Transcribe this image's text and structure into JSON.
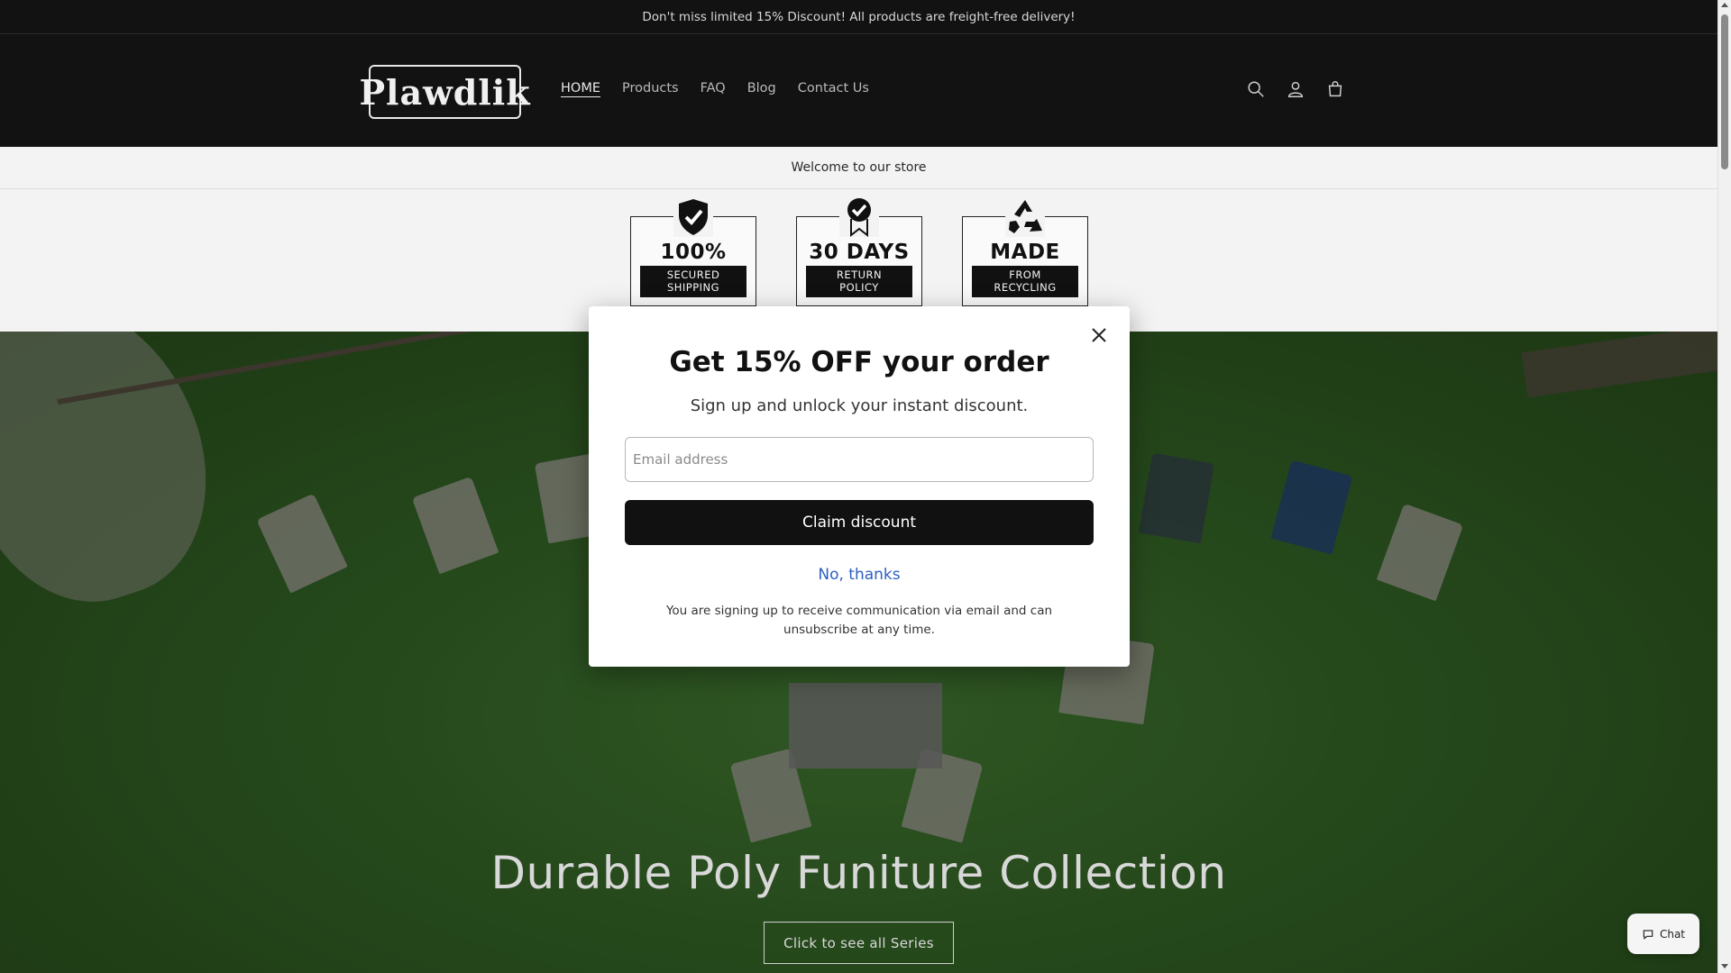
{
  "announcement": "Don't miss limited 15% Discount! All products are freight-free delivery!",
  "header": {
    "logo_text": "Plawdlik",
    "nav": [
      {
        "label": "HOME"
      },
      {
        "label": "Products"
      },
      {
        "label": "FAQ"
      },
      {
        "label": "Blog"
      },
      {
        "label": "Contact Us"
      }
    ],
    "icons": [
      "search-icon",
      "account-icon",
      "cart-icon"
    ]
  },
  "welcome_text": "Welcome to our store",
  "badges": [
    {
      "big": "100%",
      "small_1": "SECURED",
      "small_2": "SHIPPING",
      "icon": "shield-check-icon"
    },
    {
      "big": "30 DAYS",
      "small_1": "RETURN",
      "small_2": "POLICY",
      "icon": "ribbon-check-icon"
    },
    {
      "big": "MADE",
      "small_1": "FROM",
      "small_2": "RECYCLING",
      "icon": "recycle-icon"
    }
  ],
  "hero": {
    "title": "Durable Poly Funiture Collection",
    "button_label": "Click to see all Series"
  },
  "modal": {
    "title": "Get 15% OFF your order",
    "subtitle": "Sign up and unlock your instant discount.",
    "email_placeholder": "Email address",
    "email_value": "",
    "claim_label": "Claim discount",
    "decline_label": "No, thanks",
    "disclaimer": "You are signing up to receive communication via email and can unsubscribe at any time."
  },
  "chat": {
    "label": "Chat"
  },
  "colors": {
    "header_bg": "#121212",
    "accent_link": "#2d5fc4",
    "button_bg": "#111111"
  }
}
